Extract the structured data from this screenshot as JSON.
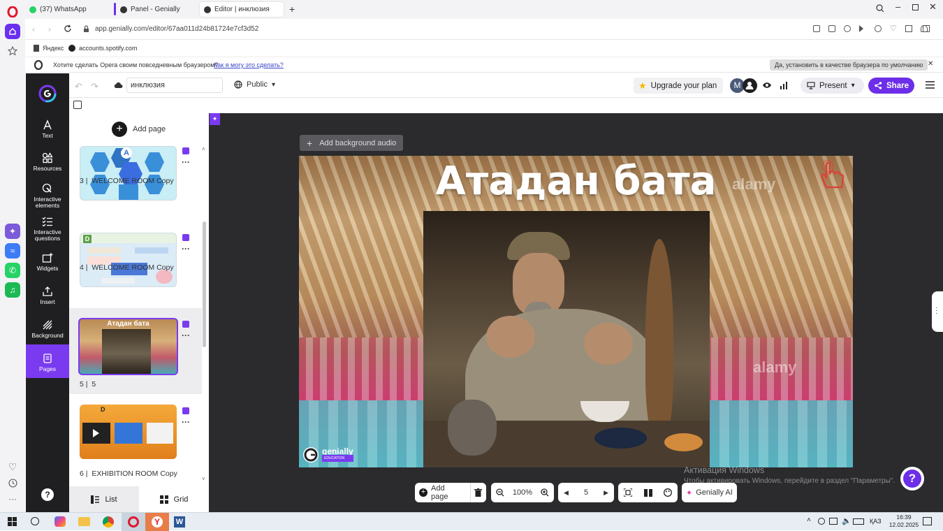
{
  "browser": {
    "tabs": [
      {
        "label": "(37) WhatsApp"
      },
      {
        "label": "Panel - Genially"
      },
      {
        "label": "Editor | инклюзия"
      }
    ],
    "url": "app.genially.com/editor/67aa011d24b81724e7cf3d52",
    "bookmarks": [
      "Яндекс",
      "accounts.spotify.com"
    ],
    "notice": {
      "text": "Хотите сделать Opera своим повседневным браузером?",
      "link": "Как я могу это сделать?",
      "button": "Да, установить в качестве браузера по умолчанию"
    }
  },
  "genially": {
    "nav": [
      {
        "label": "Text"
      },
      {
        "label": "Resources"
      },
      {
        "label": "Interactive elements"
      },
      {
        "label": "Interactive questions"
      },
      {
        "label": "Widgets"
      },
      {
        "label": "Insert"
      },
      {
        "label": "Background"
      },
      {
        "label": "Pages"
      }
    ],
    "topbar": {
      "title_value": "инклюзия",
      "visibility": "Public",
      "upgrade": "Upgrade your plan",
      "avatar_letter": "M",
      "present": "Present",
      "share": "Share"
    },
    "pages_panel": {
      "add_page": "Add page",
      "pages": [
        {
          "number": "3",
          "name": "WELCOME ROOM Copy"
        },
        {
          "number": "4",
          "name": "WELCOME ROOM Copy"
        },
        {
          "number": "5",
          "name": "5",
          "thumb_title": "Атадан бата"
        },
        {
          "number": "6",
          "name": "EXHIBITION ROOM Copy"
        }
      ],
      "view_list": "List",
      "view_grid": "Grid"
    },
    "canvas": {
      "add_audio": "Add background audio",
      "slide_title": "Атадан бата",
      "watermark": "alamy",
      "brand": "genially",
      "brand_sub": "EDUCATION"
    },
    "bottom": {
      "add_page": "Add page",
      "zoom": "100%",
      "page": "5",
      "ai": "Genially AI"
    },
    "activation": {
      "title": "Активация Windows",
      "text": "Чтобы активировать Windows, перейдите в раздел \"Параметры\"."
    }
  },
  "taskbar": {
    "lang": "ҚАЗ",
    "time": "16:39",
    "date": "12.02.2025"
  },
  "colors": {
    "accent": "#7a3bf0",
    "share": "#6c2ee8",
    "canvas_bg": "#2b2b2d",
    "nav_bg": "#1f1f21"
  }
}
